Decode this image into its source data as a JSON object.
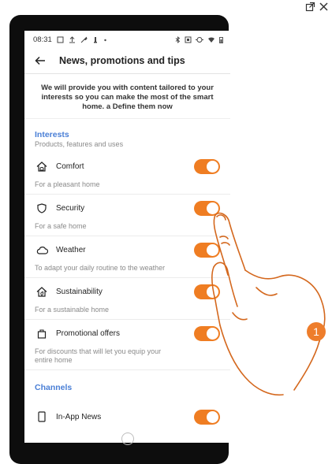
{
  "status_bar": {
    "time": "08:31",
    "left_icons": [
      "image-icon",
      "upload-icon",
      "wrench-icon",
      "user-icon",
      "dot-icon"
    ],
    "right_icons": [
      "bluetooth-icon",
      "nfc-icon",
      "data-icon",
      "wifi-icon",
      "battery-icon"
    ]
  },
  "appbar": {
    "title": "News, promotions and tips"
  },
  "intro": "We will provide you with content tailored to your interests so you can make the most of the smart home. a Define them now",
  "interests": {
    "heading": "Interests",
    "subheading": "Products, features and uses",
    "items": [
      {
        "label": "Comfort",
        "desc": "For a pleasant home",
        "icon": "comfort-house-icon",
        "enabled": true
      },
      {
        "label": "Security",
        "desc": "For a safe home",
        "icon": "shield-icon",
        "enabled": true
      },
      {
        "label": "Weather",
        "desc": "To adapt your daily routine to the weather",
        "icon": "cloud-icon",
        "enabled": true
      },
      {
        "label": "Sustainability",
        "desc": "For a sustainable home",
        "icon": "eco-house-icon",
        "enabled": true
      },
      {
        "label": "Promotional offers",
        "desc": "For discounts that will let you equip your entire home",
        "icon": "bag-icon",
        "enabled": true
      }
    ]
  },
  "channels": {
    "heading": "Channels",
    "items": [
      {
        "label": "In-App News",
        "icon": "phone-icon",
        "enabled": true
      }
    ]
  },
  "callout_number": "1",
  "colors": {
    "accent": "#ef7d22",
    "section": "#4a7fd6",
    "hand": "#d4681e"
  }
}
